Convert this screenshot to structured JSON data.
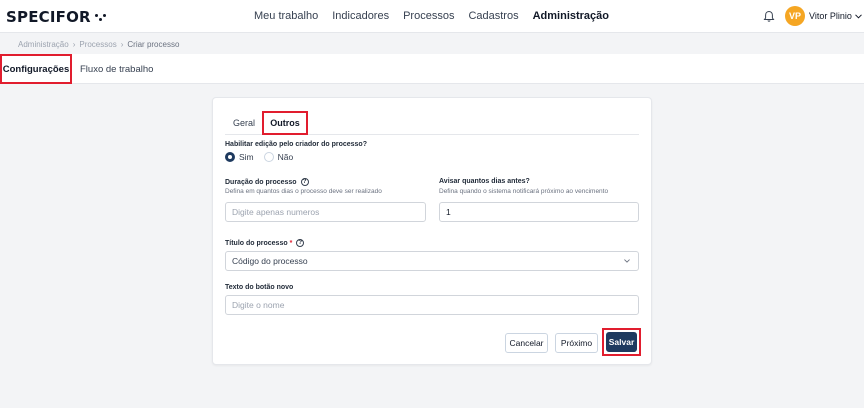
{
  "brand": {
    "name": "SPECIFOR"
  },
  "nav": {
    "items": [
      "Meu trabalho",
      "Indicadores",
      "Processos",
      "Cadastros",
      "Administração"
    ],
    "active_index": 4
  },
  "user": {
    "initials": "VP",
    "name": "Vitor Plinio",
    "avatar_color": "#f5a623"
  },
  "breadcrumb": [
    "Administração",
    "Processos",
    "Criar processo"
  ],
  "page_tabs": {
    "configuracoes": "Configurações",
    "fluxo": "Fluxo de trabalho"
  },
  "card": {
    "tabs": {
      "geral": "Geral",
      "outros": "Outros"
    },
    "edit_question": "Habilitar edição pelo criador do processo?",
    "radio_yes": "Sim",
    "radio_no": "Não",
    "selected": "Sim",
    "duration": {
      "label": "Duração do processo",
      "hint": "Defina em quantos dias o processo deve ser realizado",
      "placeholder": "Digite apenas numeros"
    },
    "warn": {
      "label": "Avisar quantos dias antes?",
      "hint": "Defina quando o sistema notificará próximo ao vencimento",
      "value": "1"
    },
    "title_field": {
      "label": "Título do processo",
      "required_mark": "*",
      "selected": "Código do processo"
    },
    "button_text": {
      "label": "Texto do botão novo",
      "placeholder": "Digite o nome"
    },
    "buttons": {
      "cancel": "Cancelar",
      "next": "Próximo",
      "save": "Salvar"
    }
  },
  "colors": {
    "accent": "#1e3a5f",
    "highlight": "#e11d2e",
    "required": "#e11d2e"
  }
}
